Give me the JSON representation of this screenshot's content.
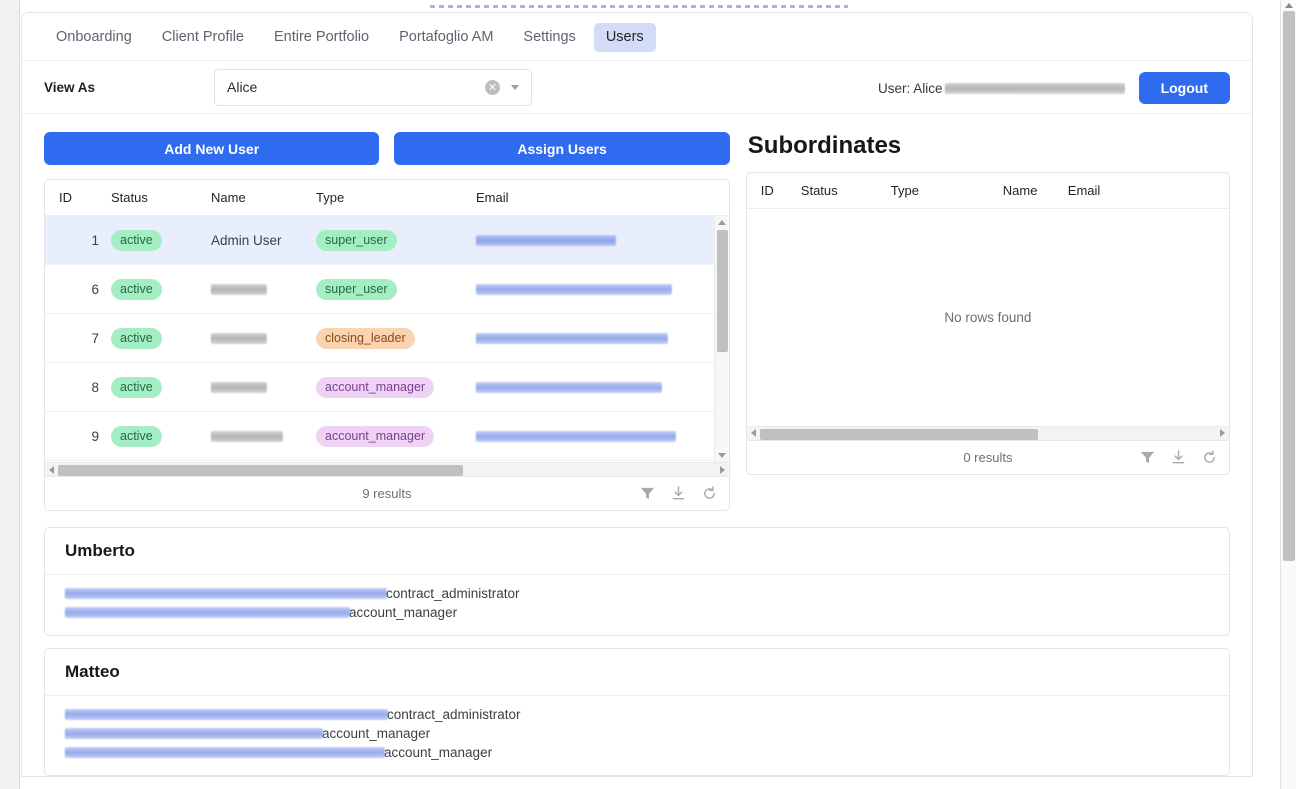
{
  "tabs": [
    {
      "label": "Onboarding",
      "active": false
    },
    {
      "label": "Client Profile",
      "active": false
    },
    {
      "label": "Entire Portfolio",
      "active": false
    },
    {
      "label": "Portafoglio AM",
      "active": false
    },
    {
      "label": "Settings",
      "active": false
    },
    {
      "label": "Users",
      "active": true
    }
  ],
  "viewas": {
    "label": "View As",
    "selected": "Alice",
    "placeholder": "Alice",
    "clear_icon": "clear-circle-icon",
    "caret_icon": "chevron-down-icon"
  },
  "session": {
    "user_text": "User: Alice",
    "user_email_redacted": true,
    "logout_label": "Logout"
  },
  "actions": {
    "add_new_user": "Add New User",
    "assign_users": "Assign Users"
  },
  "users_grid": {
    "columns": [
      "ID",
      "Status",
      "Name",
      "Type",
      "Email"
    ],
    "rows": [
      {
        "id": "1",
        "status": "active",
        "name": "Admin User",
        "name_redacted": false,
        "type": "super_user",
        "type_color": "green",
        "email_redacted": true,
        "email_width": 140,
        "selected": true
      },
      {
        "id": "6",
        "status": "active",
        "name": "",
        "name_redacted": true,
        "type": "super_user",
        "type_color": "green",
        "email_redacted": true,
        "email_width": 196,
        "selected": false
      },
      {
        "id": "7",
        "status": "active",
        "name": "",
        "name_redacted": true,
        "type": "closing_leader",
        "type_color": "orange",
        "email_redacted": true,
        "email_width": 192,
        "selected": false
      },
      {
        "id": "8",
        "status": "active",
        "name": "",
        "name_redacted": true,
        "type": "account_manager",
        "type_color": "purple",
        "email_redacted": true,
        "email_width": 186,
        "selected": false
      },
      {
        "id": "9",
        "status": "active",
        "name": "",
        "name_redacted": true,
        "type": "account_manager",
        "type_color": "purple",
        "email_redacted": true,
        "email_width": 200,
        "selected": false
      }
    ],
    "results_label": "9 results",
    "footer_icons": [
      "filter-icon",
      "download-icon",
      "refresh-icon"
    ]
  },
  "subordinates": {
    "title": "Subordinates",
    "columns": [
      "ID",
      "Status",
      "Type",
      "Name",
      "Email"
    ],
    "empty_message": "No rows found",
    "results_label": "0 results",
    "footer_icons": [
      "filter-icon",
      "download-icon",
      "refresh-icon"
    ]
  },
  "info_cards": [
    {
      "title": "Umberto",
      "lines": [
        {
          "name_redacted": true,
          "name_width": 322,
          "role": "contract_administrator"
        },
        {
          "name_redacted": true,
          "name_width": 285,
          "role": "account_manager"
        }
      ]
    },
    {
      "title": "Matteo",
      "lines": [
        {
          "name_redacted": true,
          "name_width": 323,
          "role": "contract_administrator"
        },
        {
          "name_redacted": true,
          "name_width": 258,
          "role": "account_manager"
        },
        {
          "name_redacted": true,
          "name_width": 320,
          "role": "account_manager"
        }
      ]
    }
  ],
  "colors": {
    "primary": "#2f6bf0",
    "tab_active_bg": "#d3dcf7",
    "row_selected_bg": "#e8eefc",
    "pill_green_bg": "#a5eec4",
    "pill_orange_bg": "#fad3b1",
    "pill_purple_bg": "#eed3f4"
  }
}
